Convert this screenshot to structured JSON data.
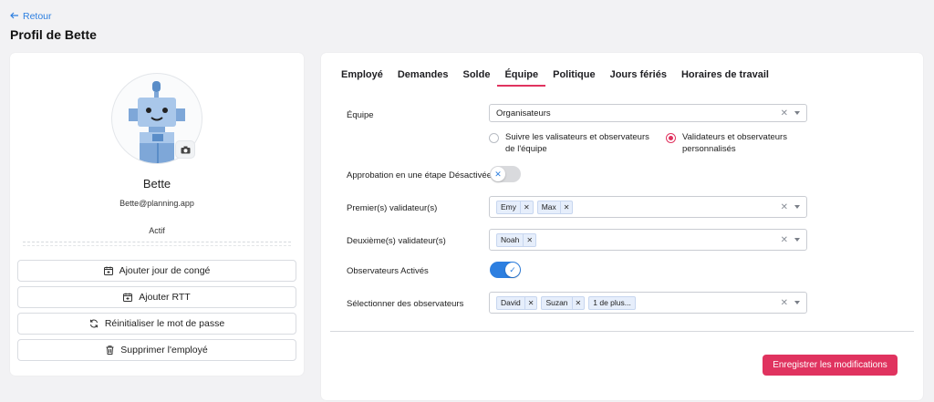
{
  "header": {
    "back_label": "Retour",
    "title": "Profil de Bette"
  },
  "profile": {
    "name": "Bette",
    "email": "Bette@planning.app",
    "status": "Actif"
  },
  "actions": [
    {
      "label": "Ajouter jour de congé",
      "icon": "calendar-plus-icon"
    },
    {
      "label": "Ajouter RTT",
      "icon": "calendar-plus-icon"
    },
    {
      "label": "Réinitialiser le mot de passe",
      "icon": "refresh-icon"
    },
    {
      "label": "Supprimer l'employé",
      "icon": "trash-icon"
    }
  ],
  "tabs": [
    {
      "label": "Employé"
    },
    {
      "label": "Demandes"
    },
    {
      "label": "Solde"
    },
    {
      "label": "Équipe",
      "active": true
    },
    {
      "label": "Politique"
    },
    {
      "label": "Jours fériés"
    },
    {
      "label": "Horaires de travail"
    }
  ],
  "form": {
    "team_label": "Équipe",
    "team_value": "Organisateurs",
    "radio_follow": "Suivre les valisateurs et observateurs de l'équipe",
    "radio_custom": "Validateurs et observateurs personnalisés",
    "single_step_label": "Approbation en une étape Désactivée",
    "first_validators_label": "Premier(s) validateur(s)",
    "first_validators": [
      "Emy",
      "Max"
    ],
    "second_validators_label": "Deuxième(s) validateur(s)",
    "second_validators": [
      "Noah"
    ],
    "observers_enabled_label": "Observateurs Activés",
    "select_observers_label": "Sélectionner des observateurs",
    "observers": [
      "David",
      "Suzan"
    ],
    "observers_more": "1 de plus..."
  },
  "save_label": "Enregistrer les modifications",
  "colors": {
    "accent": "#e0335f",
    "link": "#2d7fe0"
  }
}
